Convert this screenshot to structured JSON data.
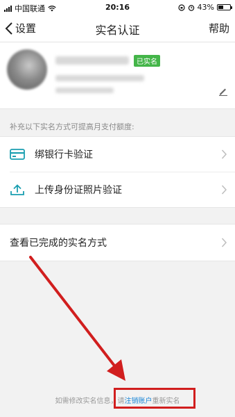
{
  "status_bar": {
    "carrier": "中国联通",
    "time": "20:16",
    "battery": "43%",
    "battery_level": 0.43
  },
  "nav": {
    "back_label": "设置",
    "title": "实名认证",
    "help_label": "帮助"
  },
  "profile": {
    "verified_badge": "已实名"
  },
  "hint": "补充以下实名方式可提高月支付额度:",
  "methods": [
    {
      "icon": "bank-card-icon",
      "label": "绑银行卡验证"
    },
    {
      "icon": "upload-icon",
      "label": "上传身份证照片验证"
    }
  ],
  "completed_methods_label": "查看已完成的实名方式",
  "footer": {
    "prefix": "如需修改实名信息，请",
    "link": "注销账户",
    "suffix": "重新实名"
  },
  "colors": {
    "accent_link": "#1a86d6",
    "verified_green": "#44b549",
    "annotation_red": "#d11e1e"
  }
}
